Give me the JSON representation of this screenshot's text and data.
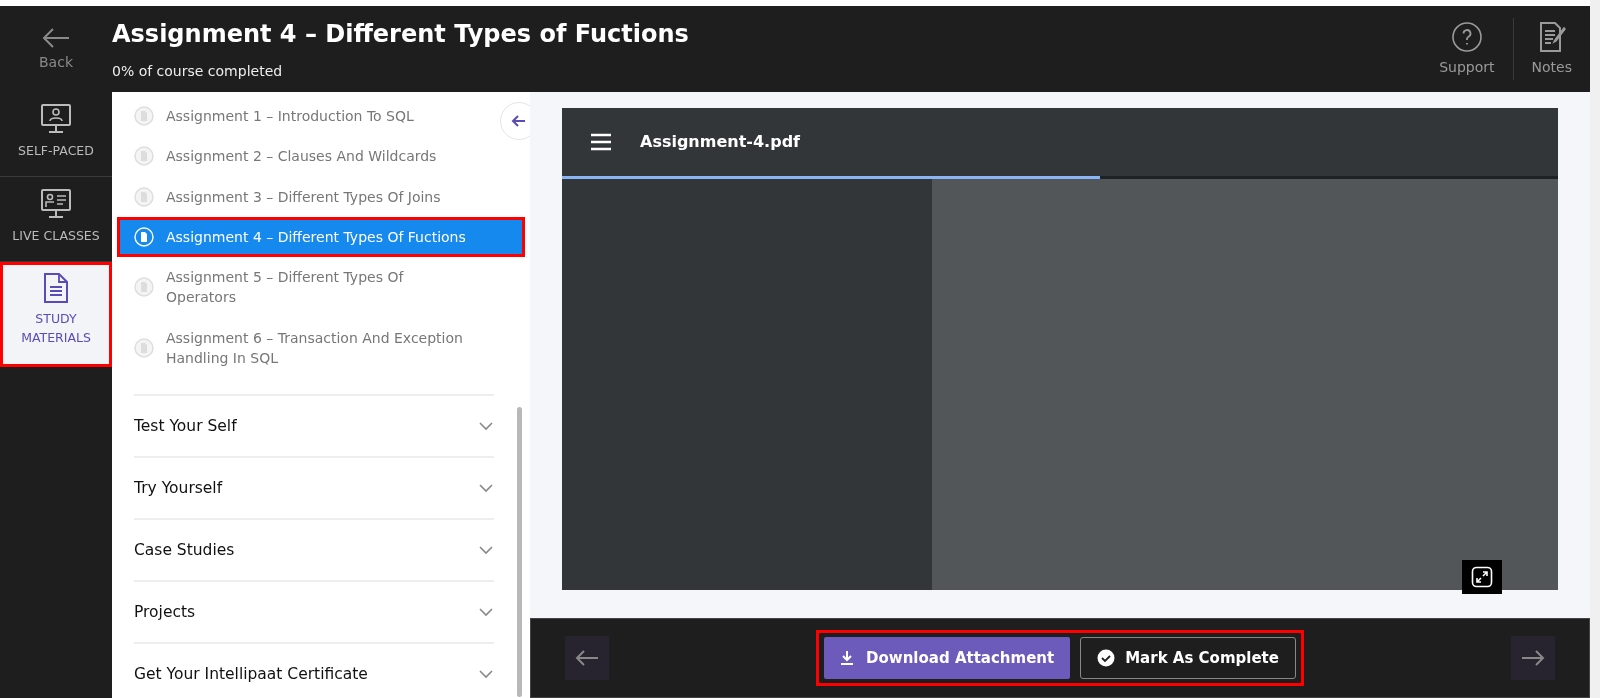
{
  "header": {
    "back_label": "Back",
    "title": "Assignment 4 – Different Types of Fuctions",
    "progress_text": "0% of course completed",
    "actions": [
      {
        "label": "Support",
        "kind": "support"
      },
      {
        "label": "Notes",
        "kind": "notes"
      }
    ]
  },
  "rail": [
    {
      "label": "SELF-PACED",
      "kind": "self-paced",
      "selected": false,
      "annotated": false
    },
    {
      "label": "LIVE CLASSES",
      "kind": "live",
      "selected": false,
      "annotated": false
    },
    {
      "label": "STUDY MATERIALS",
      "kind": "study",
      "selected": true,
      "annotated": true
    }
  ],
  "assignments": [
    {
      "label": "Assignment 1 – Introduction To SQL",
      "selected": false,
      "annotated": false
    },
    {
      "label": "Assignment 2 – Clauses And Wildcards",
      "selected": false,
      "annotated": false
    },
    {
      "label": "Assignment 3 – Different Types Of Joins",
      "selected": false,
      "annotated": false
    },
    {
      "label": "Assignment 4 – Different Types Of Fuctions",
      "selected": true,
      "annotated": true
    },
    {
      "label": "Assignment 5 – Different Types Of Operators",
      "selected": false,
      "annotated": false
    },
    {
      "label": "Assignment 6 – Transaction And Exception Handling In SQL",
      "selected": false,
      "annotated": false
    }
  ],
  "sections": [
    {
      "label": "Test Your Self",
      "expanded": false
    },
    {
      "label": "Try Yourself",
      "expanded": false
    },
    {
      "label": "Case Studies",
      "expanded": false
    },
    {
      "label": "Projects",
      "expanded": false
    },
    {
      "label": "Get Your Intellipaat Certificate",
      "expanded": false
    }
  ],
  "viewer": {
    "file_name": "Assignment-4.pdf",
    "level": 0.54
  },
  "footer": {
    "annotated": true,
    "buttons": [
      {
        "label": "Download Attachment",
        "kind": "download"
      },
      {
        "label": "Mark As Complete",
        "kind": "complete"
      }
    ]
  }
}
